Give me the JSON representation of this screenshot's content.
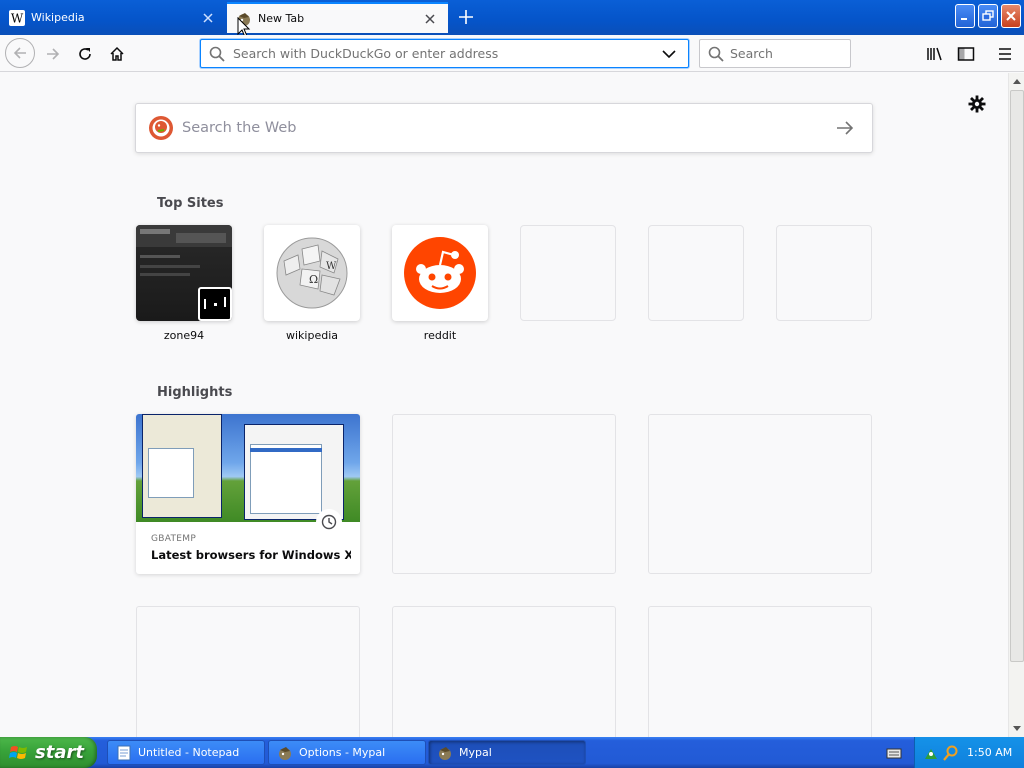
{
  "tabs": [
    {
      "title": "Wikipedia",
      "active": false
    },
    {
      "title": "New Tab",
      "active": true
    }
  ],
  "toolbar": {
    "url_placeholder": "Search with DuckDuckGo or enter address",
    "search_placeholder": "Search"
  },
  "newtab": {
    "web_search_placeholder": "Search the Web",
    "top_sites_heading": "Top Sites",
    "highlights_heading": "Highlights",
    "top_sites": [
      {
        "label": "zone94"
      },
      {
        "label": "wikipedia"
      },
      {
        "label": "reddit"
      },
      {
        "label": ""
      },
      {
        "label": ""
      },
      {
        "label": ""
      }
    ],
    "highlights": [
      {
        "source": "GBATEMP",
        "title": "Latest browsers for Windows XP..."
      }
    ]
  },
  "taskbar": {
    "start_label": "start",
    "tasks": [
      {
        "label": "Untitled - Notepad",
        "icon": "notepad-icon"
      },
      {
        "label": "Options - Mypal",
        "icon": "mypal-icon"
      },
      {
        "label": "Mypal",
        "icon": "mypal-icon",
        "active": true
      }
    ],
    "clock": "1:50 AM"
  },
  "colors": {
    "accent": "#0a84ff",
    "titlebar": "#0554c9",
    "taskbar": "#245edb",
    "start_green": "#38a33a",
    "reddit": "#ff4500",
    "duckduckgo": "#de5833"
  }
}
